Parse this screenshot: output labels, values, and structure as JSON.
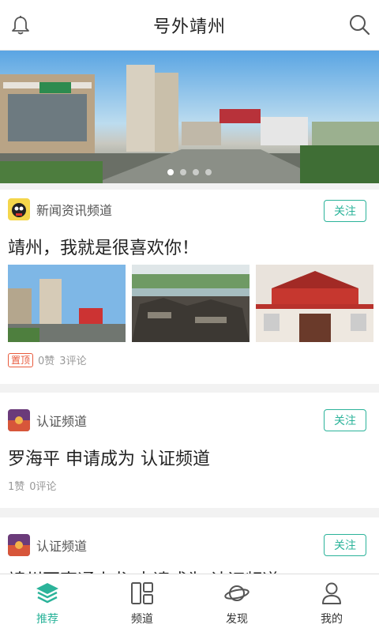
{
  "app": {
    "title": "号外靖州"
  },
  "banner": {
    "dot_count": 4,
    "active_index": 0
  },
  "feed": [
    {
      "channel": "新闻资讯频道",
      "follow_label": "关注",
      "headline": "靖州，我就是很喜欢你！",
      "pin_label": "置顶",
      "likes": "0赞",
      "comments": "3评论"
    },
    {
      "channel": "认证频道",
      "follow_label": "关注",
      "headline": "罗海平 申请成为 认证频道",
      "likes": "1赞",
      "comments": "0评论"
    },
    {
      "channel": "认证频道",
      "follow_label": "关注",
      "headline": "靖州百事通小龙 申请成为 认证频道"
    }
  ],
  "tabbar": {
    "tabs": [
      {
        "label": "推荐",
        "icon": "layers-icon",
        "active": true
      },
      {
        "label": "频道",
        "icon": "grid-icon",
        "active": false
      },
      {
        "label": "发现",
        "icon": "planet-icon",
        "active": false
      },
      {
        "label": "我的",
        "icon": "person-icon",
        "active": false
      }
    ]
  },
  "colors": {
    "accent": "#2bb39a",
    "pin": "#e85a3c"
  }
}
